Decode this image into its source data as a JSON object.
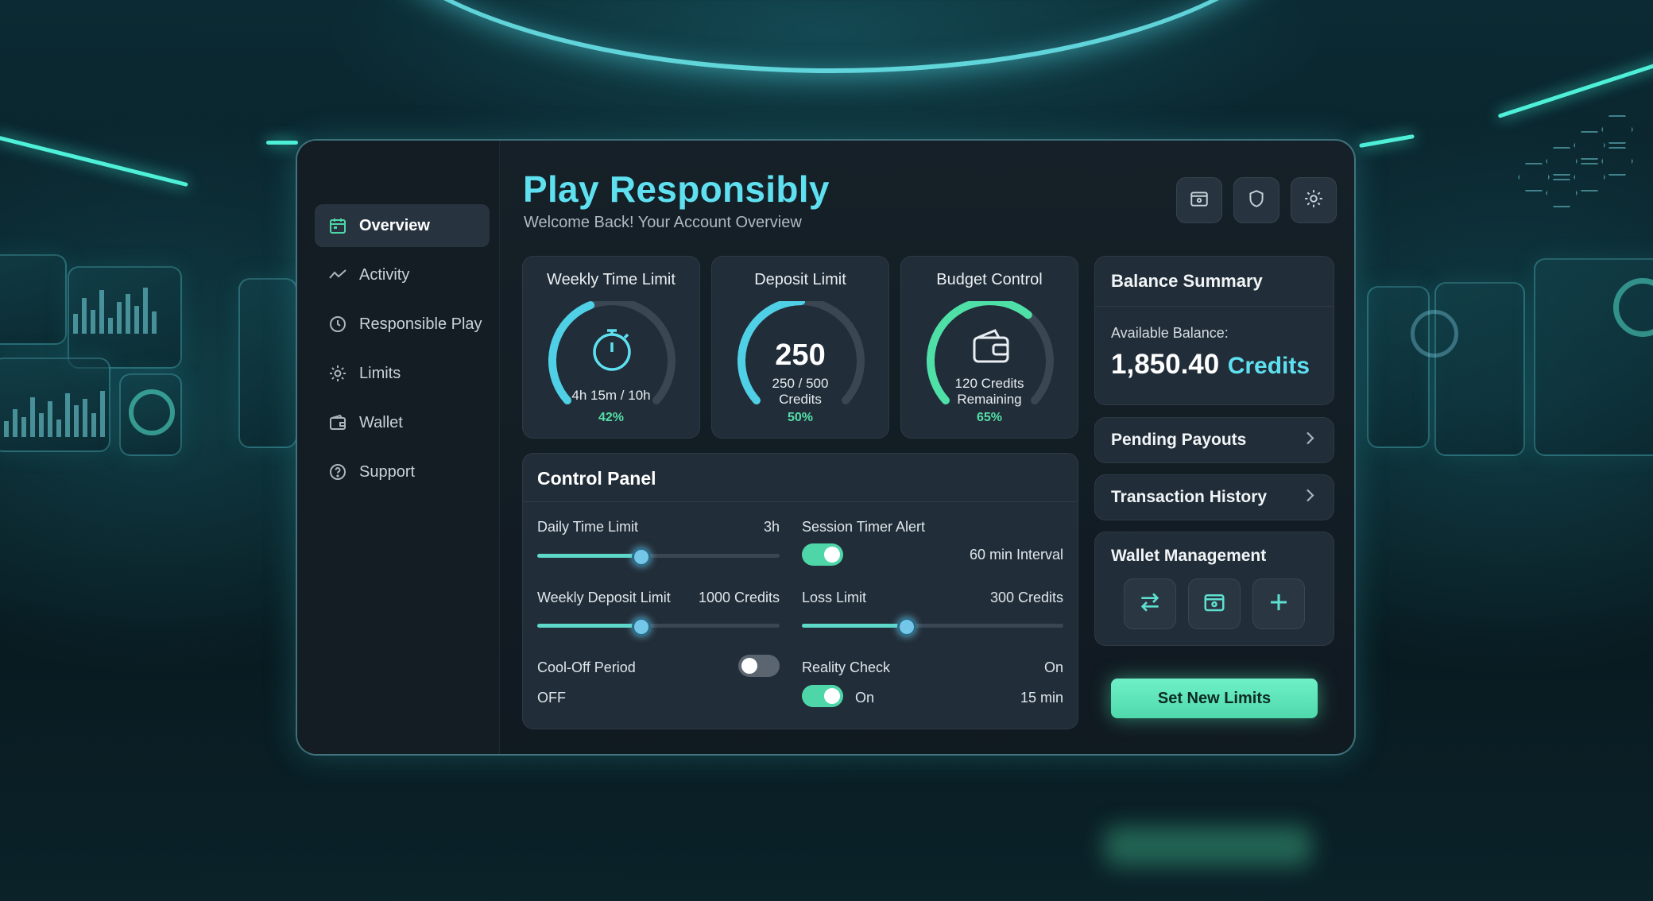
{
  "app": {
    "title": "Play Responsibly",
    "subtitle": "Welcome Back! Your Account Overview"
  },
  "sidebar": {
    "items": [
      {
        "label": "Overview",
        "icon": "calendar-icon",
        "active": true
      },
      {
        "label": "Activity",
        "icon": "activity-icon",
        "active": false
      },
      {
        "label": "Responsible Play",
        "icon": "clock-icon",
        "active": false
      },
      {
        "label": "Limits",
        "icon": "gear-icon",
        "active": false
      },
      {
        "label": "Wallet",
        "icon": "wallet-icon",
        "active": false
      },
      {
        "label": "Support",
        "icon": "help-icon",
        "active": false
      }
    ]
  },
  "header_actions": [
    {
      "icon": "wallet-card-icon"
    },
    {
      "icon": "shield-icon"
    },
    {
      "icon": "gear-icon"
    }
  ],
  "gauges": {
    "weekly_time": {
      "title": "Weekly Time Limit",
      "value_text": "4h 15m / 10h",
      "percent_text": "42%",
      "fraction": 0.42,
      "icon": "stopwatch-icon"
    },
    "deposit": {
      "title": "Deposit Limit",
      "big_value": "250",
      "line1": "250 / 500",
      "line2": "Credits",
      "percent_text": "50%",
      "fraction": 0.5
    },
    "budget": {
      "title": "Budget Control",
      "line1": "120 Credits",
      "line2": "Remaining",
      "percent_text": "65%",
      "fraction": 0.65,
      "icon": "wallet-icon"
    }
  },
  "control_panel": {
    "title": "Control Panel",
    "daily_time": {
      "label": "Daily Time Limit",
      "value": "3h",
      "fraction": 0.43
    },
    "session_timer": {
      "label": "Session Timer Alert",
      "interval": "60 min Interval",
      "on": true
    },
    "weekly_deposit": {
      "label": "Weekly Deposit Limit",
      "value": "1000 Credits",
      "fraction": 0.43
    },
    "loss_limit": {
      "label": "Loss Limit",
      "value": "300 Credits",
      "fraction": 0.4
    },
    "cool_off": {
      "label": "Cool-Off Period",
      "state": "OFF",
      "on": false
    },
    "reality_check": {
      "label": "Reality Check",
      "status": "On",
      "state": "On",
      "interval": "15 min",
      "on": true
    }
  },
  "balance": {
    "title": "Balance Summary",
    "label": "Available Balance:",
    "amount": "1,850.40",
    "unit": "Credits"
  },
  "links": {
    "pending_payouts": "Pending Payouts",
    "transaction_history": "Transaction History"
  },
  "wallet_management": {
    "title": "Wallet Management",
    "buttons": [
      "transfer-icon",
      "wallet-icon",
      "plus-icon"
    ]
  },
  "cta": {
    "label": "Set New Limits"
  },
  "colors": {
    "accent": "#5ee0f0",
    "green": "#55dfa8",
    "panel": "#212d38"
  }
}
